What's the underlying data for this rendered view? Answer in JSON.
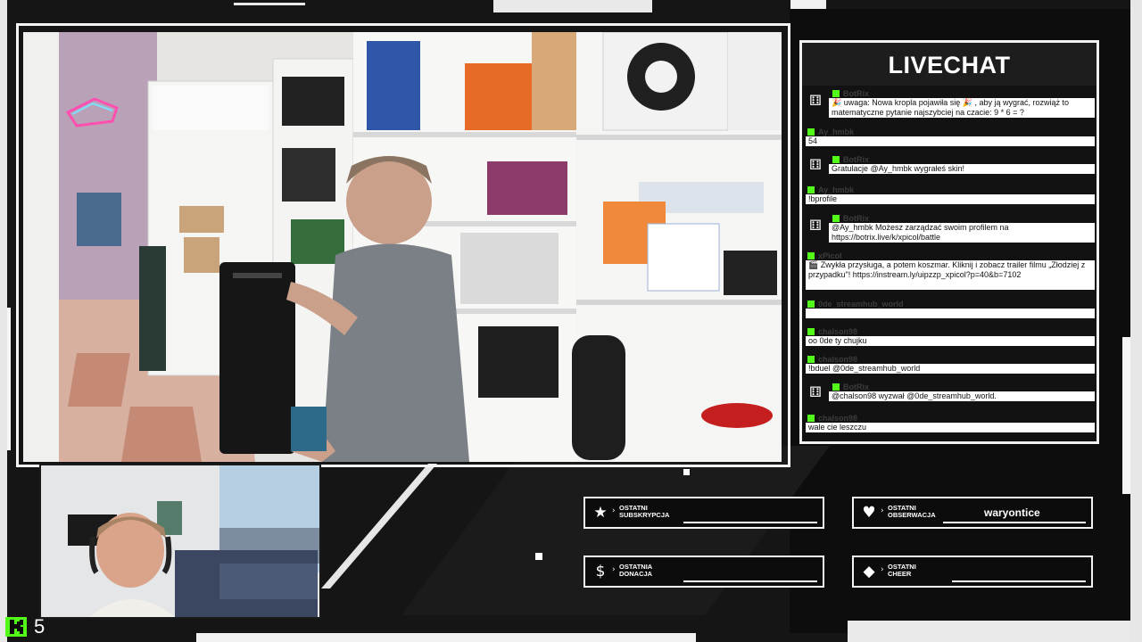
{
  "chat": {
    "title": "LIVECHAT",
    "messages": [
      {
        "user": "BotRix",
        "text": "🎉 uwaga: Nowa kropla pojawiła się 🎉 , aby ją wygrać, rozwiąż to matematyczne pytanie najszybciej na czacie: 9 * 6 = ?",
        "bot": true
      },
      {
        "user": "Ay_hmbk",
        "text": "54",
        "bot": false
      },
      {
        "user": "BotRix",
        "text": "Gratulacje @Ay_hmbk wygrałeś skin!",
        "bot": true
      },
      {
        "user": "Ay_hmbk",
        "text": "!bprofile",
        "bot": false
      },
      {
        "user": "BotRix",
        "text": "@Ay_hmbk Możesz zarządzać swoim profilem na https://botrix.live/k/xpicol/battle",
        "bot": true
      },
      {
        "user": "xPicol",
        "text": "🎬 Zwykła przysługa, a potem koszmar. Kliknij i zobacz trailer filmu „Złodziej z przypadku\"! https://instream.ly/uipzzp_xpicol?p=40&b=7102",
        "bot": false
      },
      {
        "user": "0de_streamhub_world",
        "text": "",
        "bot": false
      },
      {
        "user": "chalson98",
        "text": "oo 0de ty chujku",
        "bot": false
      },
      {
        "user": "chalson98",
        "text": "!bduel @0de_streamhub_world",
        "bot": false
      },
      {
        "user": "BotRix",
        "text": "@chalson98 wyzwał @0de_streamhub_world.",
        "bot": true
      },
      {
        "user": "chalson98",
        "text": "wale cie leszczu",
        "bot": false
      }
    ]
  },
  "events": {
    "sub": {
      "label": "OSTATNI SUBSKRYPCJA",
      "value": ""
    },
    "follow": {
      "label": "OSTATNI OBSERWACJA",
      "value": "waryontice"
    },
    "donation": {
      "label": "OSTATNIA DONACJA",
      "value": ""
    },
    "cheer": {
      "label": "OSTATNI CHEER",
      "value": ""
    }
  },
  "footer": {
    "viewer_count": "5"
  },
  "icons": {
    "sub": "star-icon",
    "follow": "heart-icon",
    "donation": "dollar-icon",
    "cheer": "diamond-icon",
    "bot": "dice-icon"
  },
  "colors": {
    "kick_green": "#53fc18",
    "background": "#161616"
  }
}
